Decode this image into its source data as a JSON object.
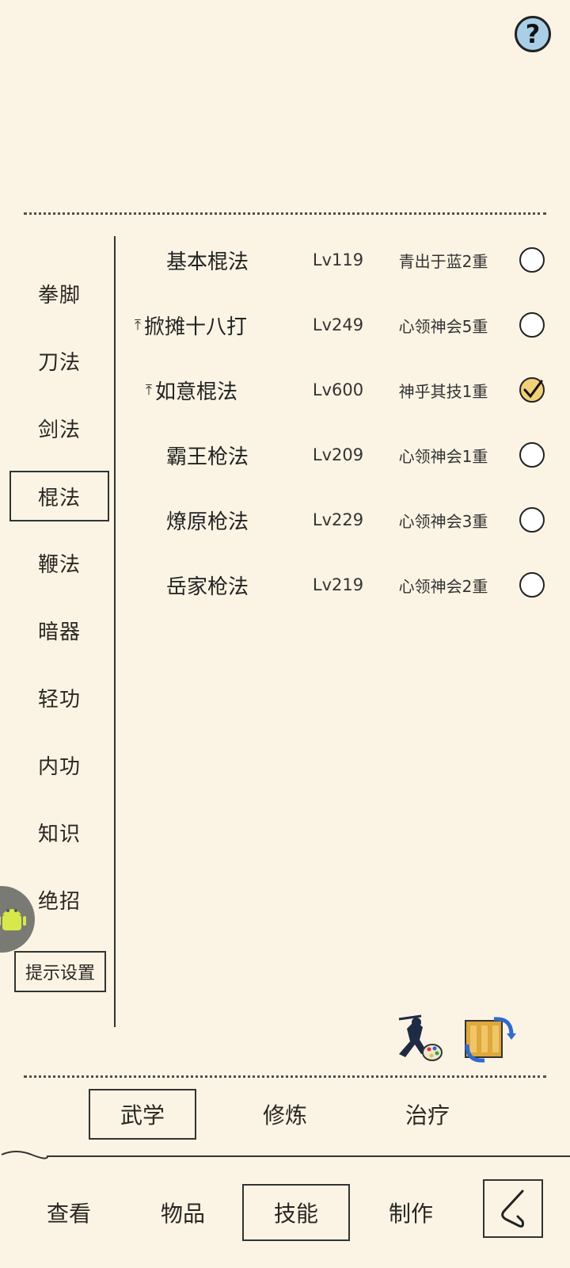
{
  "header": {
    "help_icon": "question-mark-icon",
    "help_label": "?"
  },
  "categories": [
    {
      "label": "拳脚"
    },
    {
      "label": "刀法"
    },
    {
      "label": "剑法"
    },
    {
      "label": "棍法",
      "selected": true
    },
    {
      "label": "鞭法"
    },
    {
      "label": "暗器"
    },
    {
      "label": "轻功"
    },
    {
      "label": "内功"
    },
    {
      "label": "知识"
    },
    {
      "label": "绝招"
    }
  ],
  "hint_settings_label": "提示设置",
  "skills": [
    {
      "name": "基本棍法",
      "level": "Lv119",
      "rank": "青出于蓝2重",
      "checked": false,
      "upgrade": false
    },
    {
      "name": "掀摊十八打",
      "level": "Lv249",
      "rank": "心领神会5重",
      "checked": false,
      "upgrade": true
    },
    {
      "name": "如意棍法",
      "level": "Lv600",
      "rank": "神乎其技1重",
      "checked": true,
      "upgrade": true
    },
    {
      "name": "霸王枪法",
      "level": "Lv209",
      "rank": "心领神会1重",
      "checked": false,
      "upgrade": false
    },
    {
      "name": "燎原枪法",
      "level": "Lv229",
      "rank": "心领神会3重",
      "checked": false,
      "upgrade": false
    },
    {
      "name": "岳家枪法",
      "level": "Lv219",
      "rank": "心领神会2重",
      "checked": false,
      "upgrade": false
    }
  ],
  "action_icons": [
    "ninja-painter-icon",
    "scroll-swap-icon"
  ],
  "sub_tabs": [
    {
      "label": "武学",
      "active": true
    },
    {
      "label": "修炼"
    },
    {
      "label": "治疗"
    }
  ],
  "nav_tabs": [
    {
      "label": "查看"
    },
    {
      "label": "物品"
    },
    {
      "label": "技能",
      "active": true
    },
    {
      "label": "制作"
    }
  ],
  "back_icon": "back-arrow-icon",
  "colors": {
    "background": "#fbf4e4",
    "check_fill": "#f1d07a",
    "help_fill": "#a8cfe6"
  }
}
